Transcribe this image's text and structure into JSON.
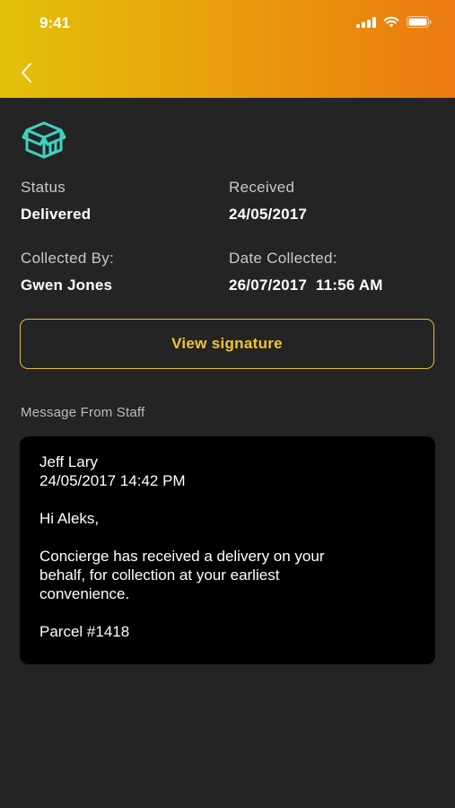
{
  "status_bar": {
    "time": "9:41"
  },
  "header": {
    "gradient_colors": [
      "#e3c10a",
      "#eb7a10"
    ]
  },
  "details": {
    "status": {
      "label": "Status",
      "value": "Delivered"
    },
    "received": {
      "label": "Received",
      "value": "24/05/2017"
    },
    "collected_by": {
      "label": "Collected By:",
      "value": "Gwen Jones"
    },
    "date_collected": {
      "label": "Date Collected:",
      "value": "26/07/2017  11:56 AM"
    }
  },
  "signature_button": {
    "label": "View signature",
    "color": "#f2c434"
  },
  "message": {
    "heading": "Message From Staff",
    "sender": "Jeff Lary",
    "timestamp": "24/05/2017 14:42 PM",
    "greeting": "Hi Aleks,",
    "body": [
      "Concierge has received a delivery on your",
      "behalf, for collection at your earliest",
      "convenience."
    ],
    "parcel": "Parcel #1418"
  },
  "icons": {
    "back": "chevron-left-icon",
    "package": "package-box-icon",
    "accent": "#3fd2c0"
  }
}
